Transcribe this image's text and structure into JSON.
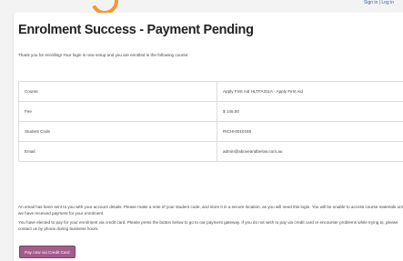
{
  "header": {
    "top_link": "Sign in | Log in"
  },
  "page": {
    "title": "Enrolment Success - Payment Pending",
    "intro": "Thank you for enrolling! Your login is now setup and you are enrolled in the following course:"
  },
  "details": [
    {
      "label": "Course",
      "value": "Apply First Aid HLTFA311A - Apply First Aid"
    },
    {
      "label": "Fee",
      "value": "$ 145.00"
    },
    {
      "label": "Student Code",
      "value": "RICHHI010159"
    },
    {
      "label": "Email",
      "value": "admin@aboveandbelow.com.au"
    }
  ],
  "messages": {
    "account_notice": "An email has been sent to you with your account details. Please make a note of your student code, and store it in a secure location, as you will need this login. You will be unable to access course materials until we have received payment for your enrolment.",
    "payment_notice": "You have elected to pay for your enrolment via credit card. Please press the button below to go to our payment gateway. If you do not wish to pay via credit card or encounter problems while trying to, please contact us by phone during business hours."
  },
  "actions": {
    "pay_button_label": "Pay now via Credit Card"
  },
  "colors": {
    "brand_orange": "#f29a2e",
    "pay_button": "#a45c8a"
  }
}
